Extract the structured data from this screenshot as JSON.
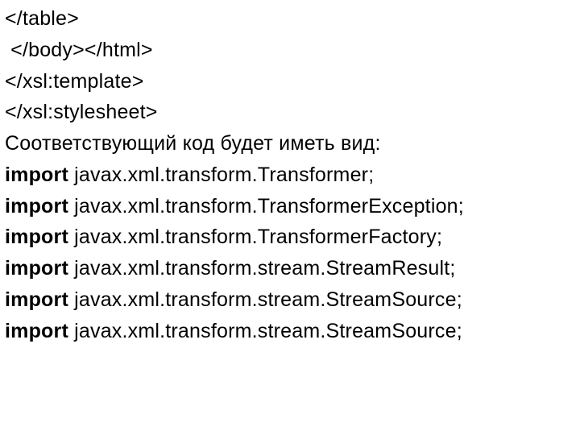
{
  "lines": [
    {
      "segments": [
        {
          "text": "</table>",
          "bold": false
        }
      ]
    },
    {
      "segments": [
        {
          "text": " </body></html>",
          "bold": false
        }
      ]
    },
    {
      "segments": [
        {
          "text": "</xsl:template>",
          "bold": false
        }
      ]
    },
    {
      "segments": [
        {
          "text": "</xsl:stylesheet>",
          "bold": false
        }
      ]
    },
    {
      "segments": [
        {
          "text": "Соответствующий код будет иметь вид:",
          "bold": false
        }
      ]
    },
    {
      "segments": [
        {
          "text": "import",
          "bold": true
        },
        {
          "text": " javax.xml.transform.Transformer;",
          "bold": false
        }
      ]
    },
    {
      "segments": [
        {
          "text": "import",
          "bold": true
        },
        {
          "text": " javax.xml.transform.TransformerException;",
          "bold": false
        }
      ]
    },
    {
      "segments": [
        {
          "text": "import",
          "bold": true
        },
        {
          "text": " javax.xml.transform.TransformerFactory;",
          "bold": false
        }
      ]
    },
    {
      "segments": [
        {
          "text": "import",
          "bold": true
        },
        {
          "text": " javax.xml.transform.stream.StreamResult;",
          "bold": false
        }
      ]
    },
    {
      "segments": [
        {
          "text": "import",
          "bold": true
        },
        {
          "text": " javax.xml.transform.stream.StreamSource;",
          "bold": false
        }
      ]
    },
    {
      "segments": [
        {
          "text": "import",
          "bold": true
        },
        {
          "text": " javax.xml.transform.stream.StreamSource;",
          "bold": false
        }
      ]
    }
  ]
}
